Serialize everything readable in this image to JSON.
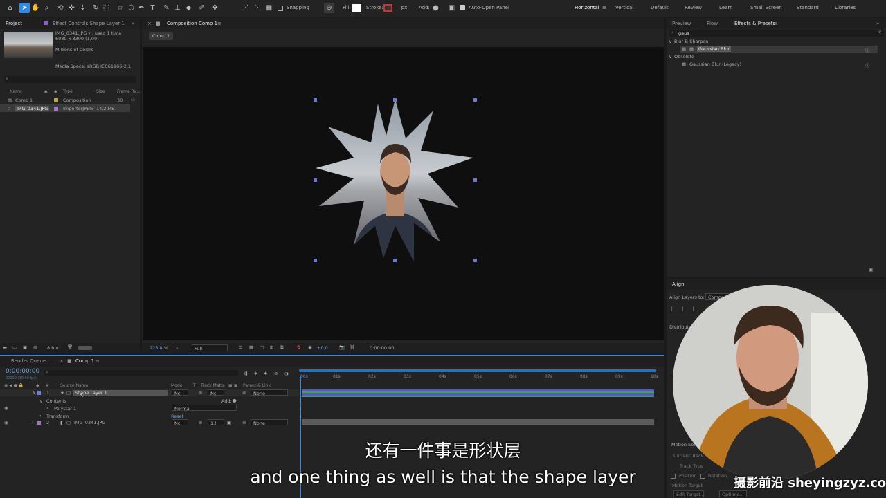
{
  "toolbar": {
    "snapping": "Snapping",
    "fill": "Fill:",
    "stroke": "Stroke:",
    "px": "– px",
    "add": "Add:",
    "auto_open": "Auto-Open Panel",
    "workspaces": [
      "Horizontal",
      "Vertical",
      "Default",
      "Review",
      "Learn",
      "Small Screen",
      "Standard",
      "Libraries"
    ]
  },
  "project_panel": {
    "tab_project": "Project",
    "tab_effect_controls": "Effect Controls Shape Layer 1",
    "item_name": "IMG_0341.JPG ▾ , used 1 time",
    "item_size": "6080 x 3300 (1,00)",
    "item_colors": "Millions of Colors",
    "media_space": "Media Space: sRGB IEC61966-2.1",
    "search_placeholder": "",
    "columns": [
      "Name",
      "Type",
      "Size",
      "Frame Ra..."
    ],
    "items": [
      {
        "name": "Comp 1",
        "type": "Composition",
        "size": "",
        "frame": "30"
      },
      {
        "name": "IMG_0341.JPG",
        "type": "ImporterJPEG",
        "size": "14,2 MB",
        "frame": ""
      }
    ],
    "bpc": "8 bpc"
  },
  "composition": {
    "tab": "Composition Comp 1",
    "breadcrumb": "Comp 1",
    "zoom": "125,8",
    "zoom_unit": "%",
    "resolution": "Full",
    "exposure": "+0,0",
    "timecode": "0:00:00:00"
  },
  "right_panel": {
    "tabs": [
      "Preview",
      "Flow",
      "Effects & Presets"
    ],
    "search": "gaus",
    "groups": [
      {
        "name": "Blur & Sharpen",
        "items": [
          "Gaussian Blur"
        ]
      },
      {
        "name": "Obsolete",
        "items": [
          "Gaussian Blur (Legacy)"
        ]
      }
    ],
    "align_tab": "Align",
    "align_to": "Align Layers to:",
    "align_value": "Compos",
    "distribute": "Distribute",
    "motion_source": "Motion Sou",
    "current_track": "Current Track",
    "track_type": "Track Type",
    "position": "Position",
    "rotation": "Rotation",
    "motion_target": "Motion Target",
    "edit_target": "Edit Target...",
    "options": "Options..."
  },
  "timeline": {
    "tab_render": "Render Queue",
    "tab_comp": "Comp 1",
    "timecode": "0:00:00:00",
    "fps": "00000 (30.00 fps)",
    "columns": {
      "source": "Source Name",
      "mode": "Mode",
      "t": "T",
      "matte": "Track Matte",
      "parent": "Parent & Link"
    },
    "ruler": [
      "00s",
      "01s",
      "02s",
      "03s",
      "04s",
      "05s",
      "06s",
      "07s",
      "08s",
      "09s",
      "10s"
    ],
    "layers": [
      {
        "num": "1",
        "name": "Shape Layer 1",
        "mode": "Nc",
        "matte": "Nc",
        "parent": "None"
      },
      {
        "num": "2",
        "name": "IMG_0341.JPG",
        "mode": "Nc",
        "matte": "1.!",
        "parent": "None"
      }
    ],
    "contents": "Contents",
    "add": "Add:",
    "polystar": "Polystar 1",
    "polystar_mode": "Normal",
    "transform": "Transform",
    "reset": "Reset"
  },
  "subtitles": {
    "zh": "还有一件事是形状层",
    "en": "and one thing as well is that the shape layer"
  },
  "watermark": "摄影前沿 sheyingzyz.com",
  "colors": {
    "accent": "#2d8ceb",
    "handle": "#6a7bd6",
    "layer_bar": "#4e5fb8",
    "layer_green": "#4a9b55"
  }
}
